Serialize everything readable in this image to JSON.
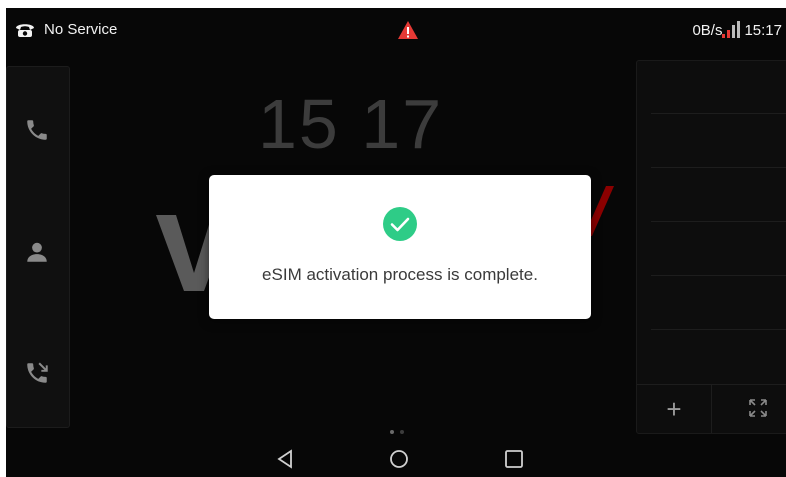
{
  "statusbar": {
    "service_text": "No Service",
    "network_speed": "0B/s",
    "time": "15:17"
  },
  "home": {
    "clock_display": "15 17",
    "brand_color": "#8b0000"
  },
  "dialog": {
    "message": "eSIM activation process is complete.",
    "success_color": "#2ecc87"
  },
  "right_panel": {
    "add_label": "+"
  },
  "icons": {
    "phone_status": "telephone-icon",
    "alert": "warning-icon",
    "signal": "signal-bars-icon",
    "call": "phone-icon",
    "contacts": "contact-icon",
    "history": "call-history-icon",
    "expand": "expand-icon",
    "back": "back-triangle-icon",
    "home": "home-circle-icon",
    "recents": "recents-square-icon",
    "success": "check-circle-icon"
  }
}
